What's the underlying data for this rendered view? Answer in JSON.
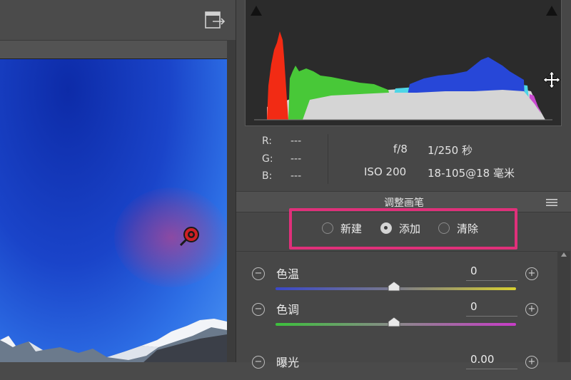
{
  "toolbar": {
    "export_icon": "export-panel-icon"
  },
  "info": {
    "r_label": "R:",
    "r_value": "---",
    "g_label": "G:",
    "g_value": "---",
    "b_label": "B:",
    "b_value": "---",
    "aperture": "f/8",
    "shutter": "1/250 秒",
    "iso": "ISO 200",
    "lens": "18-105@18 毫米"
  },
  "section": {
    "title": "调整画笔",
    "menu_icon": "panel-menu-icon"
  },
  "mode": {
    "options": [
      {
        "label": "新建",
        "selected": false
      },
      {
        "label": "添加",
        "selected": true
      },
      {
        "label": "清除",
        "selected": false
      }
    ]
  },
  "sliders": [
    {
      "label": "色温",
      "value": "0",
      "minus_icon": "minus-icon",
      "plus_icon": "plus-icon"
    },
    {
      "label": "色调",
      "value": "0",
      "minus_icon": "minus-icon",
      "plus_icon": "plus-icon"
    },
    {
      "label": "曝光",
      "value": "0.00",
      "minus_icon": "minus-icon",
      "plus_icon": "plus-icon"
    }
  ],
  "colors": {
    "highlight_box": "#e0307a",
    "panel_bg": "#474747"
  }
}
